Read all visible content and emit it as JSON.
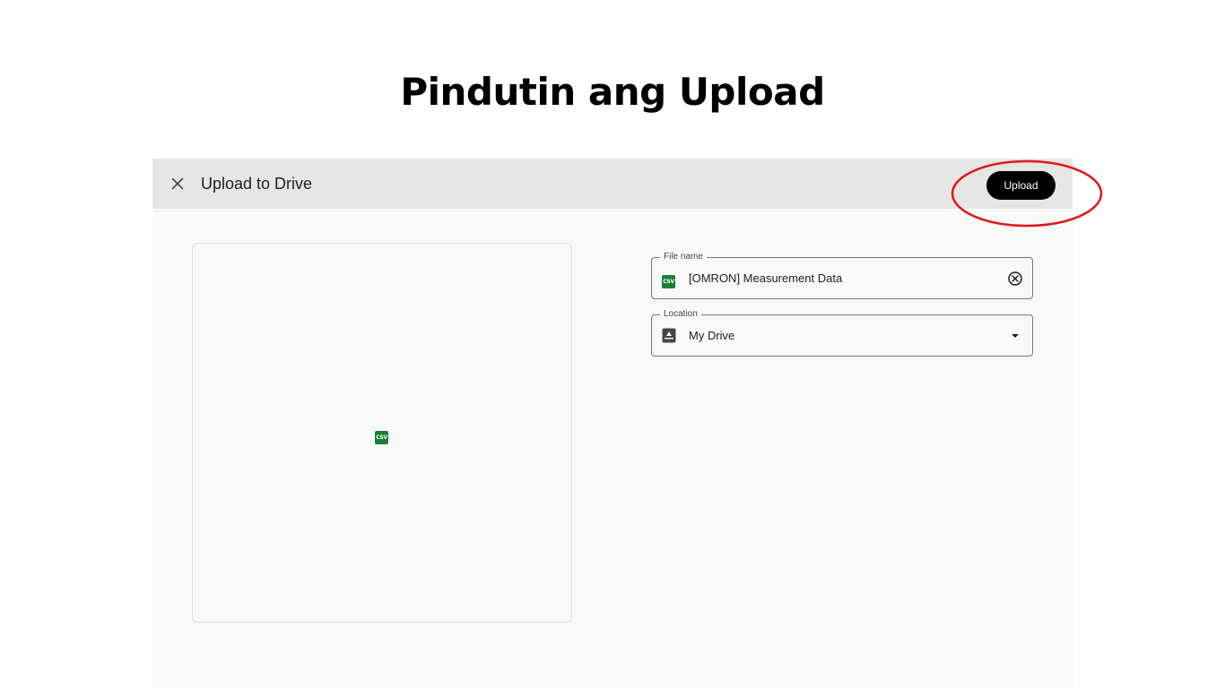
{
  "slide": {
    "title": "Pindutin ang Upload"
  },
  "dialog": {
    "title": "Upload to Drive",
    "upload_label": "Upload",
    "highlight_color": "#e0191e"
  },
  "preview": {
    "file_type_badge": "CSV"
  },
  "form": {
    "file_name": {
      "label": "File name",
      "value": "[OMRON] Measurement Data",
      "icon": "csv-file-icon",
      "action_icon": "clear-circle-icon",
      "badge": "CSV"
    },
    "location": {
      "label": "Location",
      "value": "My Drive",
      "icon": "my-drive-icon",
      "action_icon": "dropdown-arrow-icon"
    }
  },
  "colors": {
    "accent_button": "#000000",
    "csv_green": "#188038",
    "topbar_bg": "#e6e6e6",
    "panel_bg": "#f8f8f8"
  }
}
